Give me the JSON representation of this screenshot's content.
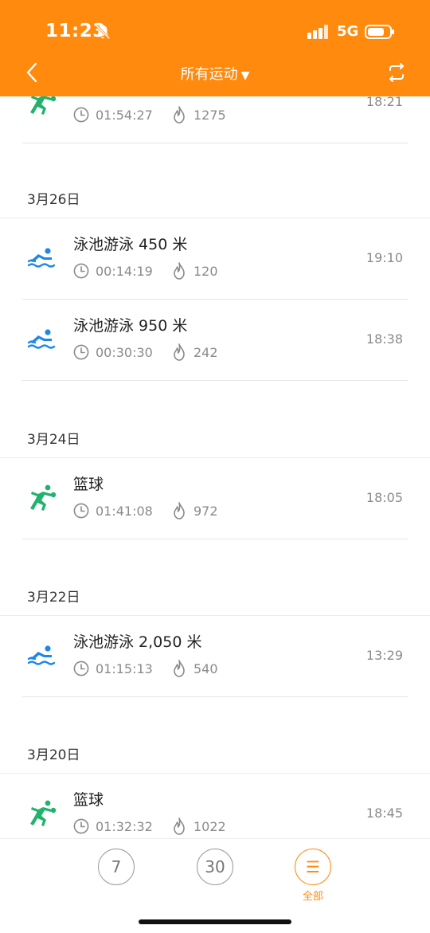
{
  "status_bar": {
    "time": "11:23",
    "network": "5G"
  },
  "header": {
    "title": "所有运动",
    "title_arrow": "▼"
  },
  "top_partial": {
    "duration": "01:54:27",
    "calories": "1275",
    "time": "18:21",
    "icon": "basketball-icon"
  },
  "sections": [
    {
      "date": "3月26日",
      "items": [
        {
          "name": "泳池游泳 450 米",
          "duration": "00:14:19",
          "calories": "120",
          "time": "19:10",
          "icon": "swim-icon"
        },
        {
          "name": "泳池游泳 950 米",
          "duration": "00:30:30",
          "calories": "242",
          "time": "18:38",
          "icon": "swim-icon"
        }
      ]
    },
    {
      "date": "3月24日",
      "items": [
        {
          "name": "篮球",
          "duration": "01:41:08",
          "calories": "972",
          "time": "18:05",
          "icon": "basketball-icon"
        }
      ]
    },
    {
      "date": "3月22日",
      "items": [
        {
          "name": "泳池游泳 2,050 米",
          "duration": "01:15:13",
          "calories": "540",
          "time": "13:29",
          "icon": "swim-icon"
        }
      ]
    },
    {
      "date": "3月20日",
      "items": [
        {
          "name": "篮球",
          "duration": "01:32:32",
          "calories": "1022",
          "time": "18:45",
          "icon": "basketball-icon"
        }
      ]
    }
  ],
  "tabs": [
    {
      "label": "7"
    },
    {
      "label": "30"
    },
    {
      "label": "☰",
      "caption": "全部"
    }
  ],
  "colors": {
    "accent": "#FF8A0E",
    "swim": "#1E88E5",
    "basketball": "#21B26B"
  }
}
